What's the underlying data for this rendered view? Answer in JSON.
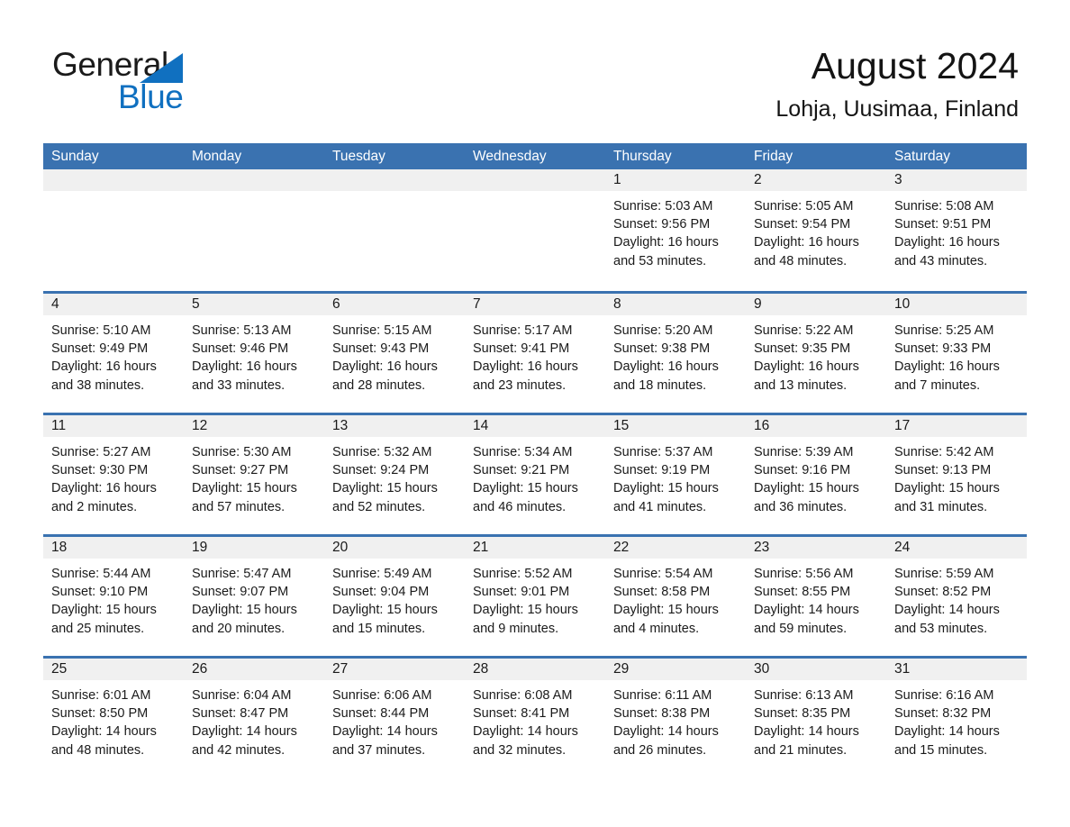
{
  "brand": {
    "line1": "General",
    "line2": "Blue",
    "mark": "triangle-logo-icon",
    "accent_color": "#1070C0"
  },
  "header": {
    "title": "August 2024",
    "subtitle": "Lohja, Uusimaa, Finland"
  },
  "theme": {
    "header_blue": "#3A72B0",
    "row_rule_blue": "#3A72B0",
    "day_number_band": "#F0F0F0",
    "page_background": "#FFFFFF"
  },
  "calendar": {
    "weekdays": [
      "Sunday",
      "Monday",
      "Tuesday",
      "Wednesday",
      "Thursday",
      "Friday",
      "Saturday"
    ],
    "labels": {
      "sunrise": "Sunrise:",
      "sunset": "Sunset:",
      "daylight": "Daylight:"
    },
    "weeks": [
      [
        {
          "empty": true
        },
        {
          "empty": true
        },
        {
          "empty": true
        },
        {
          "empty": true
        },
        {
          "day": "1",
          "sunrise": "Sunrise: 5:03 AM",
          "sunset": "Sunset: 9:56 PM",
          "daylight_1": "Daylight: 16 hours",
          "daylight_2": "and 53 minutes."
        },
        {
          "day": "2",
          "sunrise": "Sunrise: 5:05 AM",
          "sunset": "Sunset: 9:54 PM",
          "daylight_1": "Daylight: 16 hours",
          "daylight_2": "and 48 minutes."
        },
        {
          "day": "3",
          "sunrise": "Sunrise: 5:08 AM",
          "sunset": "Sunset: 9:51 PM",
          "daylight_1": "Daylight: 16 hours",
          "daylight_2": "and 43 minutes."
        }
      ],
      [
        {
          "day": "4",
          "sunrise": "Sunrise: 5:10 AM",
          "sunset": "Sunset: 9:49 PM",
          "daylight_1": "Daylight: 16 hours",
          "daylight_2": "and 38 minutes."
        },
        {
          "day": "5",
          "sunrise": "Sunrise: 5:13 AM",
          "sunset": "Sunset: 9:46 PM",
          "daylight_1": "Daylight: 16 hours",
          "daylight_2": "and 33 minutes."
        },
        {
          "day": "6",
          "sunrise": "Sunrise: 5:15 AM",
          "sunset": "Sunset: 9:43 PM",
          "daylight_1": "Daylight: 16 hours",
          "daylight_2": "and 28 minutes."
        },
        {
          "day": "7",
          "sunrise": "Sunrise: 5:17 AM",
          "sunset": "Sunset: 9:41 PM",
          "daylight_1": "Daylight: 16 hours",
          "daylight_2": "and 23 minutes."
        },
        {
          "day": "8",
          "sunrise": "Sunrise: 5:20 AM",
          "sunset": "Sunset: 9:38 PM",
          "daylight_1": "Daylight: 16 hours",
          "daylight_2": "and 18 minutes."
        },
        {
          "day": "9",
          "sunrise": "Sunrise: 5:22 AM",
          "sunset": "Sunset: 9:35 PM",
          "daylight_1": "Daylight: 16 hours",
          "daylight_2": "and 13 minutes."
        },
        {
          "day": "10",
          "sunrise": "Sunrise: 5:25 AM",
          "sunset": "Sunset: 9:33 PM",
          "daylight_1": "Daylight: 16 hours",
          "daylight_2": "and 7 minutes."
        }
      ],
      [
        {
          "day": "11",
          "sunrise": "Sunrise: 5:27 AM",
          "sunset": "Sunset: 9:30 PM",
          "daylight_1": "Daylight: 16 hours",
          "daylight_2": "and 2 minutes."
        },
        {
          "day": "12",
          "sunrise": "Sunrise: 5:30 AM",
          "sunset": "Sunset: 9:27 PM",
          "daylight_1": "Daylight: 15 hours",
          "daylight_2": "and 57 minutes."
        },
        {
          "day": "13",
          "sunrise": "Sunrise: 5:32 AM",
          "sunset": "Sunset: 9:24 PM",
          "daylight_1": "Daylight: 15 hours",
          "daylight_2": "and 52 minutes."
        },
        {
          "day": "14",
          "sunrise": "Sunrise: 5:34 AM",
          "sunset": "Sunset: 9:21 PM",
          "daylight_1": "Daylight: 15 hours",
          "daylight_2": "and 46 minutes."
        },
        {
          "day": "15",
          "sunrise": "Sunrise: 5:37 AM",
          "sunset": "Sunset: 9:19 PM",
          "daylight_1": "Daylight: 15 hours",
          "daylight_2": "and 41 minutes."
        },
        {
          "day": "16",
          "sunrise": "Sunrise: 5:39 AM",
          "sunset": "Sunset: 9:16 PM",
          "daylight_1": "Daylight: 15 hours",
          "daylight_2": "and 36 minutes."
        },
        {
          "day": "17",
          "sunrise": "Sunrise: 5:42 AM",
          "sunset": "Sunset: 9:13 PM",
          "daylight_1": "Daylight: 15 hours",
          "daylight_2": "and 31 minutes."
        }
      ],
      [
        {
          "day": "18",
          "sunrise": "Sunrise: 5:44 AM",
          "sunset": "Sunset: 9:10 PM",
          "daylight_1": "Daylight: 15 hours",
          "daylight_2": "and 25 minutes."
        },
        {
          "day": "19",
          "sunrise": "Sunrise: 5:47 AM",
          "sunset": "Sunset: 9:07 PM",
          "daylight_1": "Daylight: 15 hours",
          "daylight_2": "and 20 minutes."
        },
        {
          "day": "20",
          "sunrise": "Sunrise: 5:49 AM",
          "sunset": "Sunset: 9:04 PM",
          "daylight_1": "Daylight: 15 hours",
          "daylight_2": "and 15 minutes."
        },
        {
          "day": "21",
          "sunrise": "Sunrise: 5:52 AM",
          "sunset": "Sunset: 9:01 PM",
          "daylight_1": "Daylight: 15 hours",
          "daylight_2": "and 9 minutes."
        },
        {
          "day": "22",
          "sunrise": "Sunrise: 5:54 AM",
          "sunset": "Sunset: 8:58 PM",
          "daylight_1": "Daylight: 15 hours",
          "daylight_2": "and 4 minutes."
        },
        {
          "day": "23",
          "sunrise": "Sunrise: 5:56 AM",
          "sunset": "Sunset: 8:55 PM",
          "daylight_1": "Daylight: 14 hours",
          "daylight_2": "and 59 minutes."
        },
        {
          "day": "24",
          "sunrise": "Sunrise: 5:59 AM",
          "sunset": "Sunset: 8:52 PM",
          "daylight_1": "Daylight: 14 hours",
          "daylight_2": "and 53 minutes."
        }
      ],
      [
        {
          "day": "25",
          "sunrise": "Sunrise: 6:01 AM",
          "sunset": "Sunset: 8:50 PM",
          "daylight_1": "Daylight: 14 hours",
          "daylight_2": "and 48 minutes."
        },
        {
          "day": "26",
          "sunrise": "Sunrise: 6:04 AM",
          "sunset": "Sunset: 8:47 PM",
          "daylight_1": "Daylight: 14 hours",
          "daylight_2": "and 42 minutes."
        },
        {
          "day": "27",
          "sunrise": "Sunrise: 6:06 AM",
          "sunset": "Sunset: 8:44 PM",
          "daylight_1": "Daylight: 14 hours",
          "daylight_2": "and 37 minutes."
        },
        {
          "day": "28",
          "sunrise": "Sunrise: 6:08 AM",
          "sunset": "Sunset: 8:41 PM",
          "daylight_1": "Daylight: 14 hours",
          "daylight_2": "and 32 minutes."
        },
        {
          "day": "29",
          "sunrise": "Sunrise: 6:11 AM",
          "sunset": "Sunset: 8:38 PM",
          "daylight_1": "Daylight: 14 hours",
          "daylight_2": "and 26 minutes."
        },
        {
          "day": "30",
          "sunrise": "Sunrise: 6:13 AM",
          "sunset": "Sunset: 8:35 PM",
          "daylight_1": "Daylight: 14 hours",
          "daylight_2": "and 21 minutes."
        },
        {
          "day": "31",
          "sunrise": "Sunrise: 6:16 AM",
          "sunset": "Sunset: 8:32 PM",
          "daylight_1": "Daylight: 14 hours",
          "daylight_2": "and 15 minutes."
        }
      ]
    ]
  }
}
